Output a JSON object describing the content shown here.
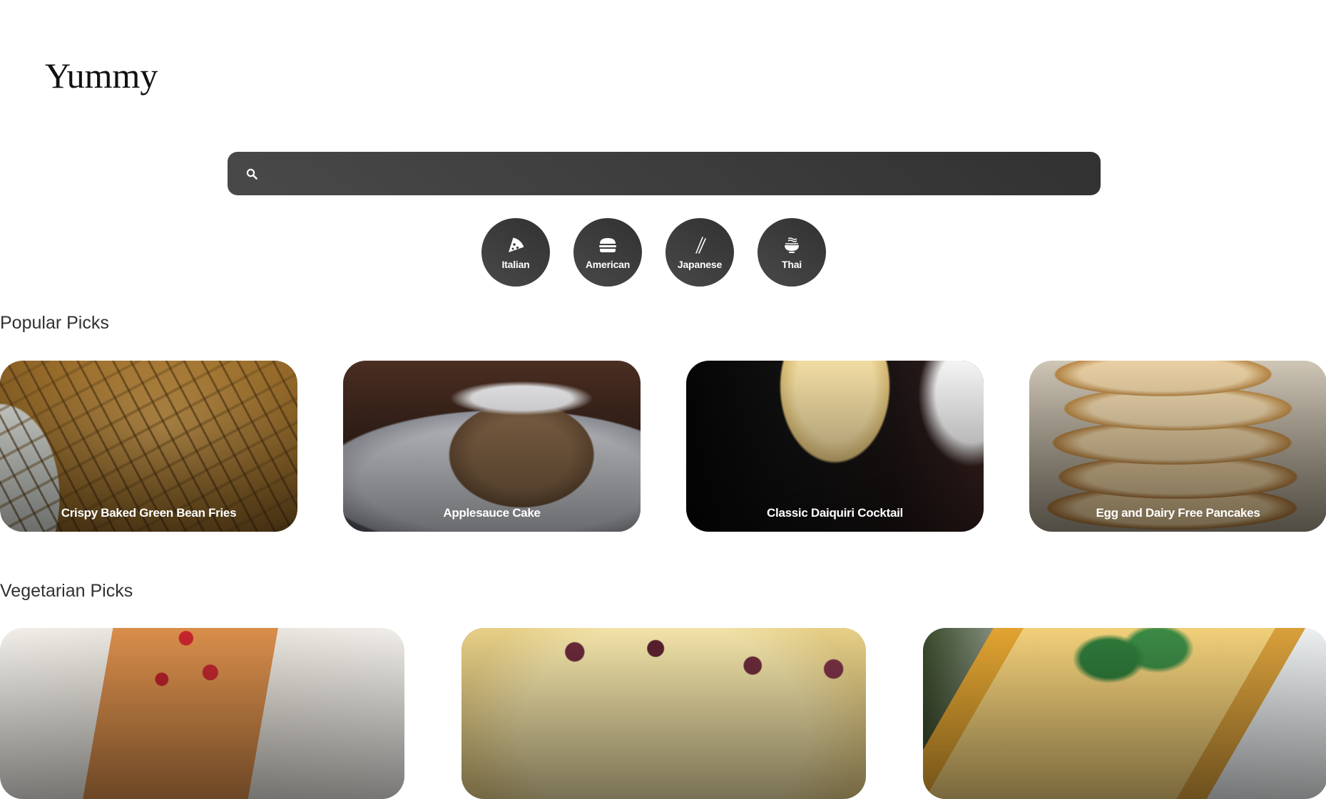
{
  "header": {
    "logo": "Yummy"
  },
  "search": {
    "value": "",
    "placeholder": ""
  },
  "categories": [
    {
      "label": "Italian",
      "icon": "pizza-icon"
    },
    {
      "label": "American",
      "icon": "burger-icon"
    },
    {
      "label": "Japanese",
      "icon": "chopsticks-icon"
    },
    {
      "label": "Thai",
      "icon": "noodle-bowl-icon"
    }
  ],
  "popular": {
    "title": "Popular Picks",
    "items": [
      {
        "title": "Crispy Baked Green Bean Fries"
      },
      {
        "title": "Applesauce Cake"
      },
      {
        "title": "Classic Daiquiri Cocktail"
      },
      {
        "title": "Egg and Dairy Free Pancakes"
      }
    ]
  },
  "vegetarian": {
    "title": "Vegetarian Picks",
    "items": [
      {
        "title": ""
      },
      {
        "title": ""
      },
      {
        "title": ""
      }
    ]
  },
  "colors": {
    "accent_dark": "#313131",
    "accent_light": "#494949",
    "text": "#313131",
    "background": "#ffffff"
  }
}
